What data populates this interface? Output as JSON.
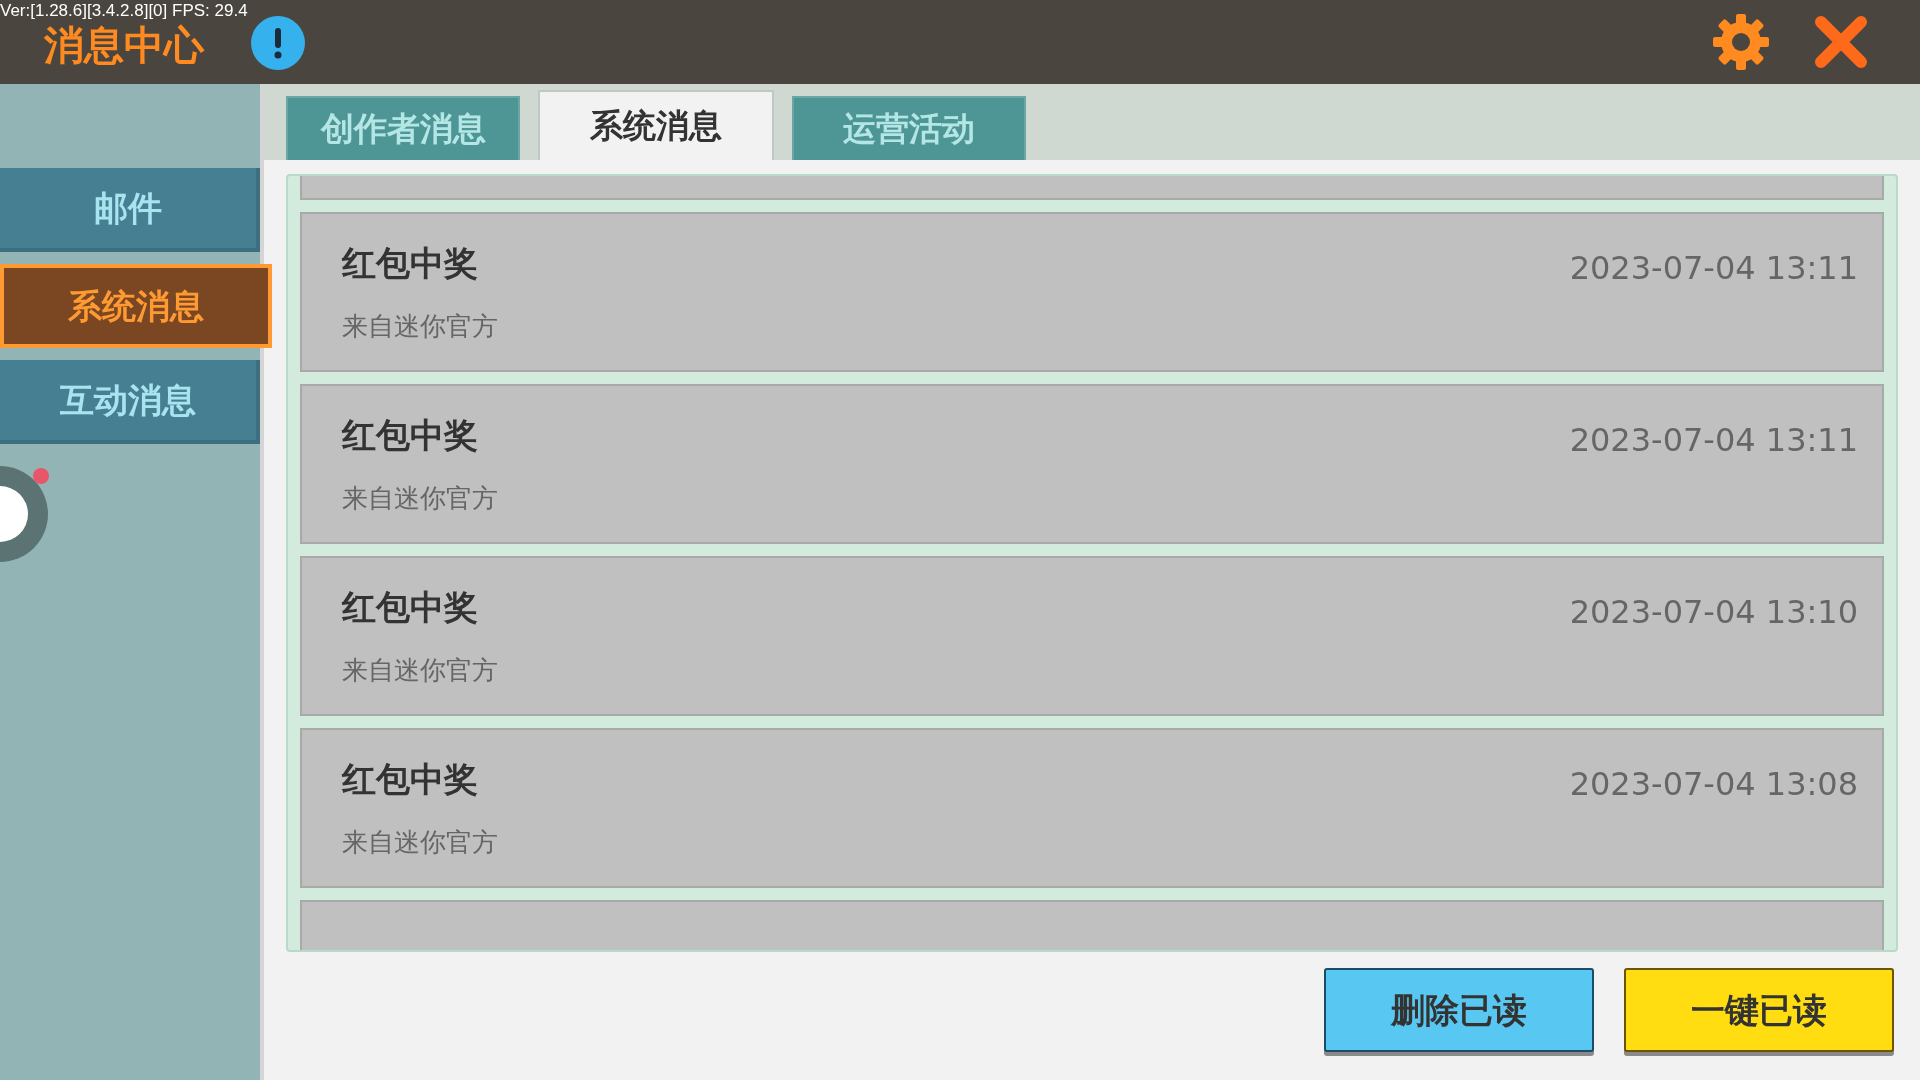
{
  "debug_overlay": "Ver:[1.28.6][3.4.2.8][0] FPS: 29.4",
  "window": {
    "title": "消息中心"
  },
  "sidebar": {
    "items": [
      {
        "label": "邮件",
        "selected": false
      },
      {
        "label": "系统消息",
        "selected": true
      },
      {
        "label": "互动消息",
        "selected": false
      }
    ]
  },
  "tabs": [
    {
      "label": "创作者消息",
      "selected": false
    },
    {
      "label": "系统消息",
      "selected": true
    },
    {
      "label": "运营活动",
      "selected": false
    }
  ],
  "messages": [
    {
      "title": "红包中奖",
      "sender": "来自迷你官方",
      "time": "2023-07-04 13:11"
    },
    {
      "title": "红包中奖",
      "sender": "来自迷你官方",
      "time": "2023-07-04 13:11"
    },
    {
      "title": "红包中奖",
      "sender": "来自迷你官方",
      "time": "2023-07-04 13:10"
    },
    {
      "title": "红包中奖",
      "sender": "来自迷你官方",
      "time": "2023-07-04 13:08"
    }
  ],
  "buttons": [
    {
      "kind": "delete",
      "label": "删除已读"
    },
    {
      "kind": "read",
      "label": "一键已读"
    }
  ]
}
